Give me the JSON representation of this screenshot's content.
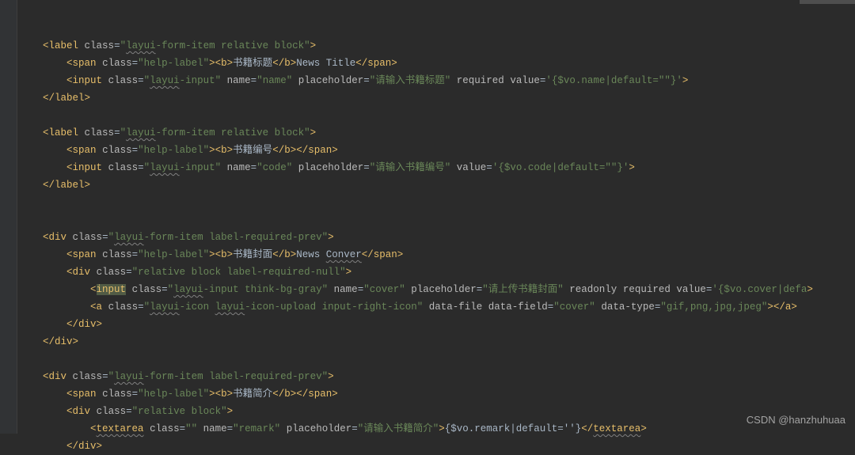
{
  "blocks": [
    {
      "tag": "label",
      "wrapClass": "layui-form-item relative block",
      "wrapWavy": "layui",
      "children": [
        {
          "tag": "span",
          "class": "help-label",
          "inner": "bold_then_text",
          "bold": "书籍标题",
          "after": "News Title"
        },
        {
          "tag": "input",
          "className": "layui-input",
          "classWavy": "layui",
          "attrs": [
            {
              "k": "name",
              "v": "name"
            },
            {
              "k": "placeholder",
              "v": "请输入书籍标题"
            },
            {
              "k": "required",
              "bare": true
            },
            {
              "k": "value",
              "v": "{$vo.name|default=\"\"}",
              "q": "'"
            }
          ]
        }
      ]
    },
    {
      "tag": "label",
      "wrapClass": "layui-form-item relative block",
      "wrapWavy": "layui",
      "children": [
        {
          "tag": "span",
          "class": "help-label",
          "inner": "bold_only",
          "bold": "书籍编号"
        },
        {
          "tag": "input",
          "className": "layui-input",
          "classWavy": "layui",
          "attrs": [
            {
              "k": "name",
              "v": "code"
            },
            {
              "k": "placeholder",
              "v": "请输入书籍编号"
            },
            {
              "k": "value",
              "v": "{$vo.code|default=\"\"}",
              "q": "'"
            }
          ]
        }
      ]
    },
    {
      "tag": "div",
      "wrapClass": "layui-form-item label-required-prev",
      "wrapWavy": "layui",
      "children": [
        {
          "tag": "span",
          "class": "help-label",
          "inner": "bold_then_text",
          "bold": "书籍封面",
          "after": "News Conver",
          "afterWavy": "Conver"
        },
        {
          "tag": "div",
          "className": "relative block label-required-null",
          "children": [
            {
              "tag": "input",
              "tagHighlight": true,
              "className": "layui-input think-bg-gray",
              "classWavy": "layui",
              "attrs": [
                {
                  "k": "name",
                  "v": "cover"
                },
                {
                  "k": "placeholder",
                  "v": "请上传书籍封面"
                },
                {
                  "k": "readonly",
                  "bare": true
                },
                {
                  "k": "required",
                  "bare": true
                },
                {
                  "k": "value",
                  "v": "{$vo.cover|defa",
                  "q": "'",
                  "unterminated": true
                }
              ]
            },
            {
              "tag": "a",
              "className": "layui-icon layui-icon-upload input-right-icon",
              "classWavy2": [
                "layui",
                "layui"
              ],
              "attrs": [
                {
                  "k": "data-file",
                  "bare": true
                },
                {
                  "k": "data-field",
                  "v": "cover"
                },
                {
                  "k": "data-type",
                  "v": "gif,png,jpg,jpeg"
                }
              ],
              "closeInline": true
            }
          ]
        }
      ]
    },
    {
      "tag": "div",
      "wrapClass": "layui-form-item label-required-prev",
      "wrapWavy": "layui",
      "children": [
        {
          "tag": "span",
          "class": "help-label",
          "inner": "bold_only",
          "bold": "书籍简介"
        },
        {
          "tag": "div",
          "className": "relative block",
          "children": [
            {
              "tag": "textarea",
              "tagWavy": true,
              "className": "",
              "attrs": [
                {
                  "k": "name",
                  "v": "remark"
                },
                {
                  "k": "placeholder",
                  "v": "请输入书籍简介"
                }
              ],
              "contentAfter": "{$vo.remark|default=''}",
              "selfCloseTag": "textarea",
              "tagWavyClose": true
            }
          ]
        }
      ]
    }
  ],
  "watermark": "CSDN @hanzhuhuaa"
}
